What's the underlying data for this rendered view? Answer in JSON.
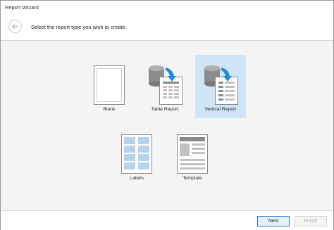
{
  "window": {
    "title": "Report Wizard"
  },
  "header": {
    "back_icon": "arrow-left-icon",
    "instruction": "Select the report type you wish to create."
  },
  "report_types": [
    {
      "label": "Blank",
      "icon": "blank-report-icon",
      "selected": false
    },
    {
      "label": "Table Report",
      "icon": "table-report-icon",
      "selected": false
    },
    {
      "label": "Vertical Report",
      "icon": "vertical-report-icon",
      "selected": true
    },
    {
      "label": "Labels",
      "icon": "labels-icon",
      "selected": false
    },
    {
      "label": "Template",
      "icon": "template-icon",
      "selected": false
    }
  ],
  "footer": {
    "next_label": "Next",
    "finish_label": "Finish",
    "finish_enabled": false
  },
  "colors": {
    "selection": "#cfe4f7",
    "accent_blue": "#2b7bd0",
    "arrow_blue": "#1e8fd6"
  }
}
